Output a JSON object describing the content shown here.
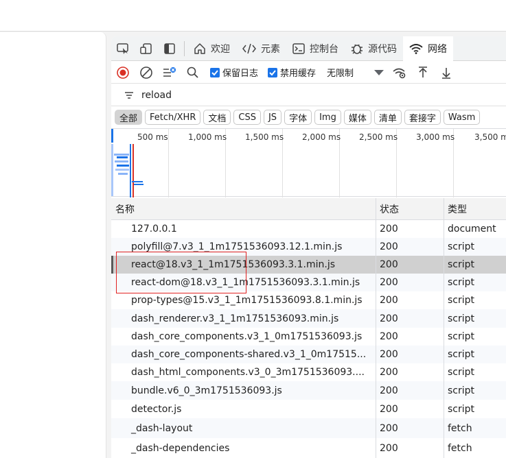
{
  "devtools": {
    "tabs": [
      {
        "label": "欢迎",
        "icon": "home-icon"
      },
      {
        "label": "元素",
        "icon": "code-icon"
      },
      {
        "label": "控制台",
        "icon": "console-icon"
      },
      {
        "label": "源代码",
        "icon": "bug-icon"
      },
      {
        "label": "网络",
        "icon": "wifi-icon",
        "active": true
      }
    ]
  },
  "toolbar": {
    "preserve_log": "保留日志",
    "disable_cache": "禁用缓存",
    "throttling": "无限制"
  },
  "filter": {
    "value": "reload"
  },
  "type_filters": [
    "全部",
    "Fetch/XHR",
    "文档",
    "CSS",
    "JS",
    "字体",
    "Img",
    "媒体",
    "清单",
    "套接字",
    "Wasm"
  ],
  "overview": {
    "ticks": [
      "500 ms",
      "1,000 ms",
      "1,500 ms",
      "2,000 ms",
      "2,500 ms",
      "3,000 ms",
      "3,500 ms"
    ]
  },
  "table": {
    "headers": {
      "name": "名称",
      "status": "状态",
      "type": "类型"
    },
    "rows": [
      {
        "name": "127.0.0.1",
        "status": "200",
        "type": "document"
      },
      {
        "name": "polyfill@7.v3_1_1m1751536093.12.1.min.js",
        "status": "200",
        "type": "script"
      },
      {
        "name": "react@18.v3_1_1m1751536093.3.1.min.js",
        "status": "200",
        "type": "script",
        "selected": true
      },
      {
        "name": "react-dom@18.v3_1_1m1751536093.3.1.min.js",
        "status": "200",
        "type": "script"
      },
      {
        "name": "prop-types@15.v3_1_1m1751536093.8.1.min.js",
        "status": "200",
        "type": "script"
      },
      {
        "name": "dash_renderer.v3_1_1m1751536093.min.js",
        "status": "200",
        "type": "script"
      },
      {
        "name": "dash_core_components.v3_1_0m1751536093.js",
        "status": "200",
        "type": "script"
      },
      {
        "name": "dash_core_components-shared.v3_1_0m17515...",
        "status": "200",
        "type": "script"
      },
      {
        "name": "dash_html_components.v3_0_3m1751536093....",
        "status": "200",
        "type": "script"
      },
      {
        "name": "bundle.v6_0_3m1751536093.js",
        "status": "200",
        "type": "script"
      },
      {
        "name": "detector.js",
        "status": "200",
        "type": "script"
      },
      {
        "name": "_dash-layout",
        "status": "200",
        "type": "fetch"
      },
      {
        "name": "_dash-dependencies",
        "status": "200",
        "type": "fetch"
      }
    ]
  },
  "colors": {
    "accent": "#1a73e8",
    "record": "#d93025",
    "annotation": "#e02020"
  }
}
